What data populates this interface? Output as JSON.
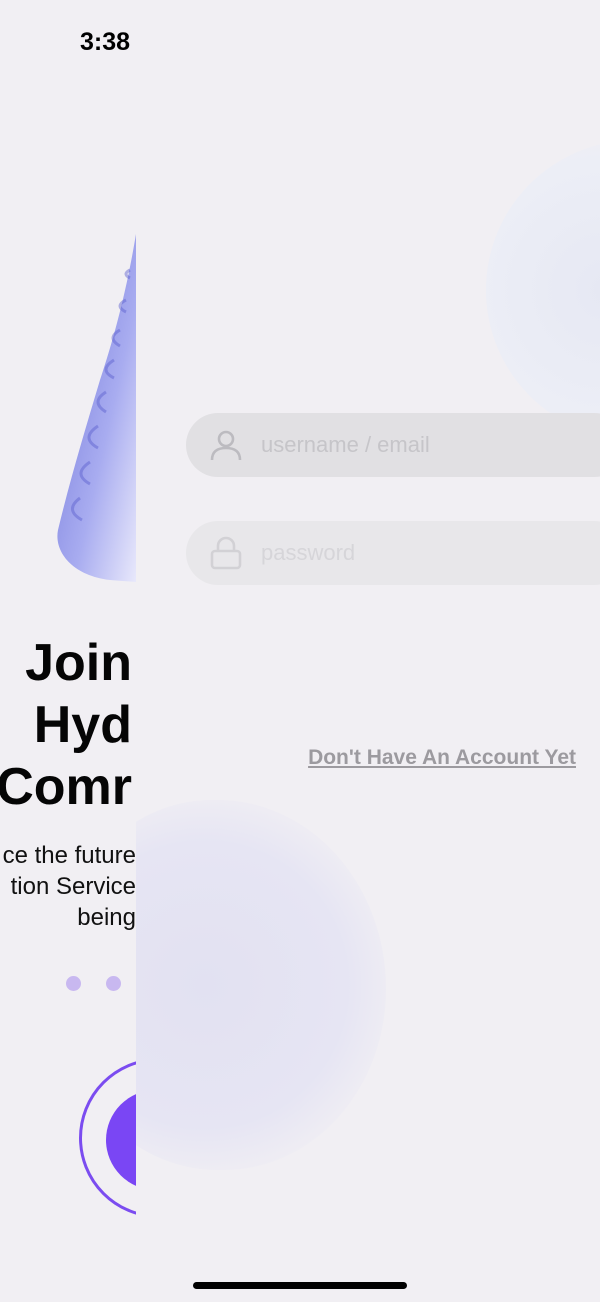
{
  "status_bar": {
    "time": "3:38"
  },
  "onboarding": {
    "title_lines": [
      "Join",
      "Hyd",
      "Comr"
    ],
    "description_lines": [
      "ce the future",
      "tion Service",
      "being"
    ],
    "pager_dot_count": 2,
    "accent_color": "#7a46f4"
  },
  "login": {
    "username_placeholder": "username / email",
    "password_placeholder": "password",
    "signup_link": "Don't Have An Account Yet"
  }
}
